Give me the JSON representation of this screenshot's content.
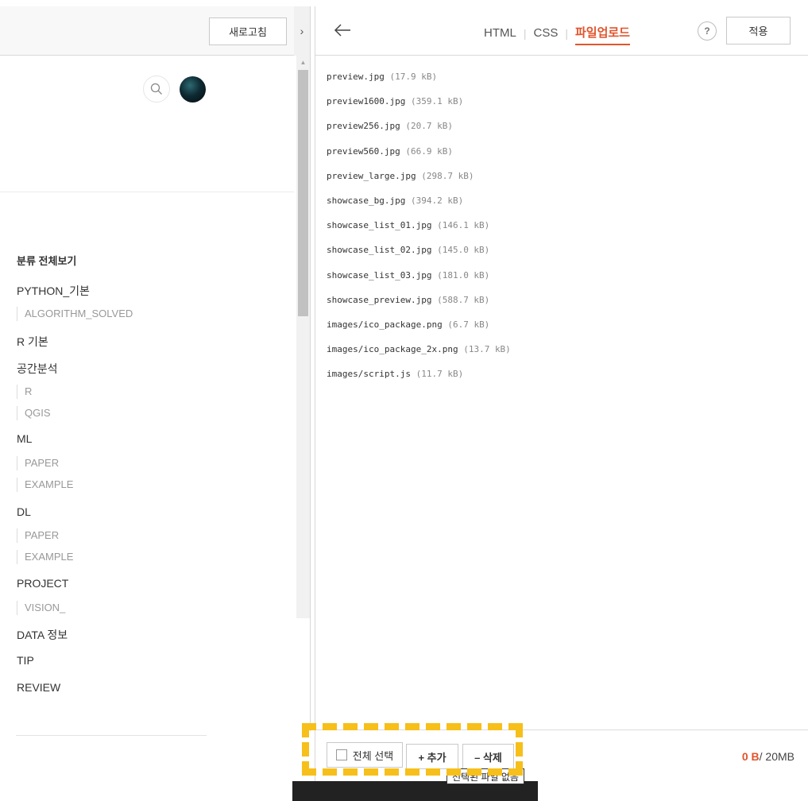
{
  "left": {
    "refresh_label": "새로고침",
    "collapse_icon": "›",
    "categories": [
      {
        "label": "분류 전체보기",
        "type": "head"
      },
      {
        "label": "PYTHON_기본",
        "type": "cat"
      },
      {
        "label": "ALGORITHM_SOLVED",
        "type": "sub"
      },
      {
        "label": "R 기본",
        "type": "cat"
      },
      {
        "label": "공간분석",
        "type": "cat"
      },
      {
        "label": "R",
        "type": "sub"
      },
      {
        "label": "QGIS",
        "type": "sub"
      },
      {
        "label": "ML",
        "type": "cat"
      },
      {
        "label": "PAPER",
        "type": "sub"
      },
      {
        "label": "EXAMPLE",
        "type": "sub"
      },
      {
        "label": "DL",
        "type": "cat"
      },
      {
        "label": "PAPER",
        "type": "sub"
      },
      {
        "label": "EXAMPLE",
        "type": "sub"
      },
      {
        "label": "PROJECT",
        "type": "cat"
      },
      {
        "label": "VISION_",
        "type": "sub"
      },
      {
        "label": "DATA 정보",
        "type": "cat"
      },
      {
        "label": "TIP",
        "type": "cat"
      },
      {
        "label": "REVIEW",
        "type": "cat"
      }
    ]
  },
  "editor": {
    "back_icon": "←",
    "tabs": [
      {
        "label": "HTML",
        "active": false
      },
      {
        "label": "CSS",
        "active": false
      },
      {
        "label": "파일업로드",
        "active": true
      }
    ],
    "help_label": "?",
    "apply_label": "적용",
    "files": [
      {
        "name": "preview.jpg",
        "size": "(17.9 kB)"
      },
      {
        "name": "preview1600.jpg",
        "size": "(359.1 kB)"
      },
      {
        "name": "preview256.jpg",
        "size": "(20.7 kB)"
      },
      {
        "name": "preview560.jpg",
        "size": "(66.9 kB)"
      },
      {
        "name": "preview_large.jpg",
        "size": "(298.7 kB)"
      },
      {
        "name": "showcase_bg.jpg",
        "size": "(394.2 kB)"
      },
      {
        "name": "showcase_list_01.jpg",
        "size": "(146.1 kB)"
      },
      {
        "name": "showcase_list_02.jpg",
        "size": "(145.0 kB)"
      },
      {
        "name": "showcase_list_03.jpg",
        "size": "(181.0 kB)"
      },
      {
        "name": "showcase_preview.jpg",
        "size": "(588.7 kB)"
      },
      {
        "name": "images/ico_package.png",
        "size": "(6.7 kB)"
      },
      {
        "name": "images/ico_package_2x.png",
        "size": "(13.7 kB)"
      },
      {
        "name": "images/script.js",
        "size": "(11.7 kB)"
      }
    ],
    "select_all_label": "전체 선택",
    "add_label": "+ 추가",
    "delete_label": "– 삭제",
    "quota_used": "0 B",
    "quota_total": "/ 20MB",
    "tooltip": "선택된 파일 없음"
  },
  "colors": {
    "accent": "#e2542c",
    "highlight": "#f6bf1a"
  }
}
